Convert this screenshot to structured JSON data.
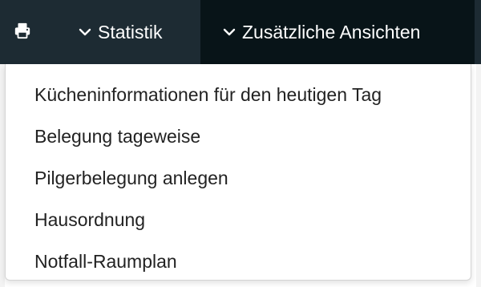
{
  "navbar": {
    "print_icon": "printer-icon",
    "statistik_label": "Statistik",
    "zusaetzliche_label": "Zusätzliche Ansichten",
    "chevron_icon": "chevron-down-icon",
    "background_color": "#1d2b33",
    "active_background_color": "#081418"
  },
  "dropdown": {
    "items": [
      {
        "label": "Kücheninformationen für den heutigen Tag"
      },
      {
        "label": "Belegung tageweise"
      },
      {
        "label": "Pilgerbelegung anlegen"
      },
      {
        "label": "Hausordnung"
      },
      {
        "label": "Notfall-Raumplan"
      }
    ]
  }
}
